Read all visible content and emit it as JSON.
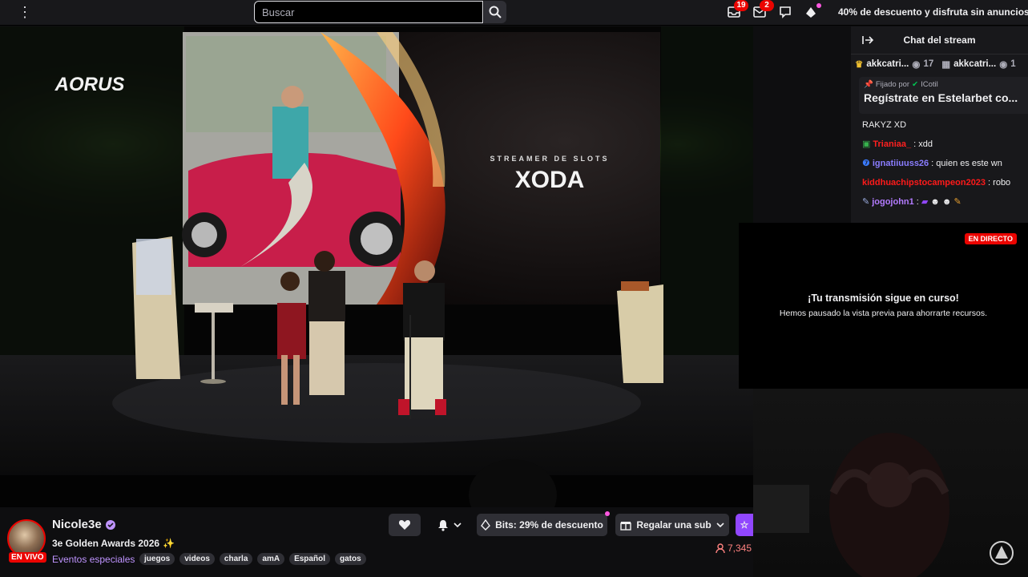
{
  "topbar": {
    "search_placeholder": "Buscar",
    "inbox_badge": "19",
    "messages_badge": "2",
    "promo_text": "40% de descuento y disfruta sin anuncios"
  },
  "video": {
    "screen_subtitle": "STREAMER DE SLOTS",
    "screen_title": "XODA",
    "sponsor_logo": "AORUS"
  },
  "chat": {
    "header_title": "Chat del stream",
    "leaderboard": [
      {
        "name": "akkcatri...",
        "count": "17"
      },
      {
        "name": "akkcatri...",
        "count": "1"
      }
    ],
    "pinned_by_label": "Fijado por",
    "pinned_by_user": "ICotil",
    "pinned_message": "Regístrate en Estelarbet co...",
    "messages": [
      {
        "user": "",
        "text": "RAKYZ XD",
        "color": "#efeff1"
      },
      {
        "user": "Trianiaa_",
        "text": ": xdd",
        "color": "#ff2020"
      },
      {
        "user": "ignatiiuuss26",
        "text": ": quien es este wn",
        "color": "#8a7dff"
      },
      {
        "user": "kiddhuachipstocampeon2023",
        "text": ": robo",
        "color": "#ff1a1a"
      },
      {
        "user": "jogojohn1",
        "text": ":",
        "color": "#b37bff"
      }
    ]
  },
  "popup": {
    "badge": "EN DIRECTO",
    "title": "¡Tu transmisión sigue en curso!",
    "subtitle": "Hemos pausado la vista previa para ahorrarte recursos."
  },
  "channel": {
    "name": "Nicole3e",
    "live_label": "EN VIVO",
    "stream_title": "3e Golden Awards 2026",
    "category": "Eventos especiales",
    "tags": [
      "juegos",
      "videos",
      "charla",
      "amA",
      "Español",
      "gatos"
    ],
    "viewers": "7,345"
  },
  "actions": {
    "bits_label": "Bits: 29% de descuento",
    "gift_label": "Regalar una sub"
  },
  "colors": {
    "accent": "#9147ff",
    "live_red": "#eb0400",
    "link": "#bf94ff"
  }
}
